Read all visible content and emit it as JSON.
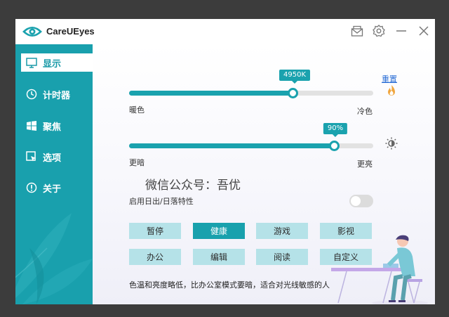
{
  "app": {
    "title": "CareUEyes"
  },
  "sidebar": {
    "items": [
      {
        "label": "显示",
        "icon": "monitor-icon",
        "active": true
      },
      {
        "label": "计时器",
        "icon": "clock-icon",
        "active": false
      },
      {
        "label": "聚焦",
        "icon": "windows-icon",
        "active": false
      },
      {
        "label": "选项",
        "icon": "cursor-window-icon",
        "active": false
      },
      {
        "label": "关于",
        "icon": "info-icon",
        "active": false
      }
    ]
  },
  "display": {
    "reset_label": "重置",
    "color_temp": {
      "value_label": "4950K",
      "fraction": 0.67,
      "left_label": "暖色",
      "right_label": "冷色"
    },
    "brightness": {
      "value_label": "90%",
      "fraction": 0.84,
      "left_label": "更暗",
      "right_label": "更亮"
    },
    "watermark": "微信公众号：吾优",
    "sunrise_toggle": {
      "label": "启用日出/日落特性",
      "on": false
    },
    "modes": [
      {
        "label": "暂停",
        "active": false
      },
      {
        "label": "健康",
        "active": true
      },
      {
        "label": "游戏",
        "active": false
      },
      {
        "label": "影视",
        "active": false
      },
      {
        "label": "办公",
        "active": false
      },
      {
        "label": "编辑",
        "active": false
      },
      {
        "label": "阅读",
        "active": false
      },
      {
        "label": "自定义",
        "active": false
      }
    ],
    "description": "色温和亮度略低，比办公室模式要暗，适合对光线敏感的人"
  },
  "colors": {
    "accent": "#1aa2ae",
    "sidebar": "#19a0ad",
    "link": "#2b6fd6"
  }
}
